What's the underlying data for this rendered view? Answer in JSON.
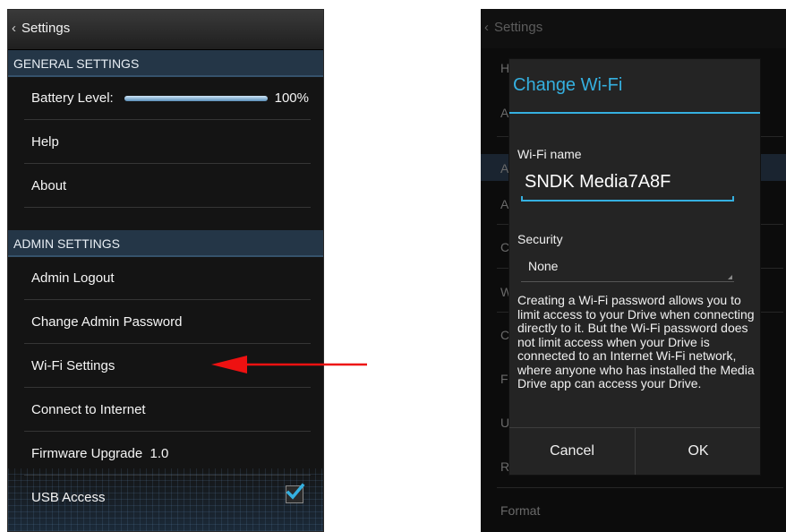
{
  "left": {
    "topbar": {
      "back_glyph": "‹",
      "title": "Settings"
    },
    "general_header": "GENERAL SETTINGS",
    "battery": {
      "label": "Battery Level:",
      "value": "100%",
      "level": 1.0
    },
    "general_items": [
      "Help",
      "About"
    ],
    "admin_header": "ADMIN SETTINGS",
    "admin_items": [
      "Admin Logout",
      "Change Admin Password",
      "Wi-Fi Settings",
      "Connect to Internet",
      "Firmware Upgrade  1.0"
    ],
    "usb": {
      "label": "USB Access",
      "checked": true
    }
  },
  "right": {
    "topbar": {
      "back_glyph": "‹",
      "title": "Settings"
    },
    "bg_letters": [
      "H",
      "A",
      "AD",
      "A",
      "C",
      "W",
      "C",
      "F",
      "U",
      "R"
    ],
    "bg_last_item": "Format",
    "dialog": {
      "title": "Change Wi-Fi",
      "name_label": "Wi-Fi name",
      "name_value": "SNDK Media7A8F",
      "security_label": "Security",
      "security_value": "None",
      "info": "Creating a Wi-Fi password allows you to limit access to your Drive when connecting directly to it. But the Wi-Fi password does not limit access when your Drive is connected to an Internet Wi-Fi network, where anyone who has installed the Media Drive app can access your Drive.",
      "cancel_label": "Cancel",
      "ok_label": "OK"
    }
  },
  "colors": {
    "accent": "#35b0e0",
    "header_bg": "#243647",
    "arrow": "#ee1111"
  }
}
